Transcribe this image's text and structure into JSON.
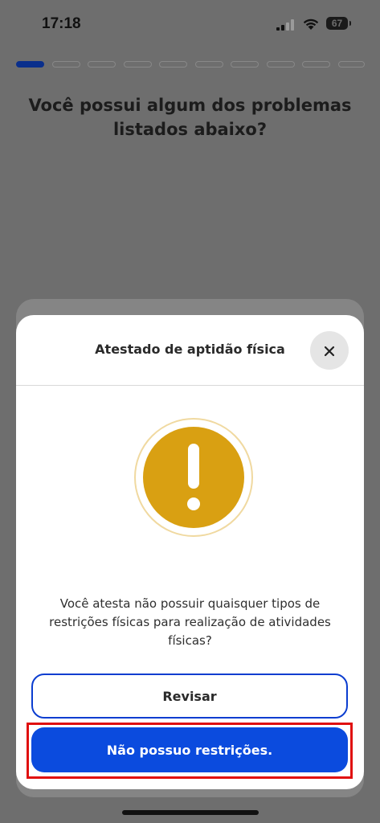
{
  "status_bar": {
    "time": "17:18",
    "battery": "67",
    "icons": [
      "signal-icon",
      "wifi-icon",
      "battery-icon"
    ]
  },
  "progress": {
    "total_steps": 10,
    "current_step": 1
  },
  "question": {
    "text": "Você possui algum dos problemas listados abaixo?"
  },
  "modal": {
    "title": "Atestado de aptidão física",
    "close_icon": "close-icon",
    "alert_icon": "exclamation-icon",
    "alert_color": "#d9a012",
    "description": "Você atesta não possuir quaisquer tipos de restrições físicas para realização de atividades físicas?",
    "review_label": "Revisar",
    "confirm_label": "Não possuo restrições."
  },
  "colors": {
    "primary": "#0b4bde",
    "outline": "#0b3dd0",
    "overlay": "#6e6e6e",
    "highlight": "#e01010"
  }
}
